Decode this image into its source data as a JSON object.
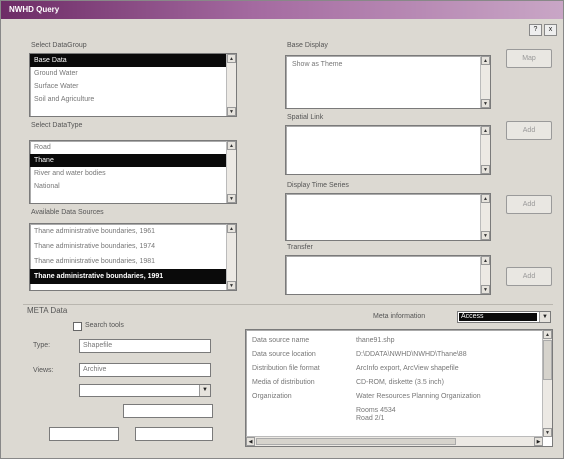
{
  "window": {
    "title": "NWHD Query"
  },
  "corner_buttons": [
    "x"
  ],
  "left": {
    "select_datagroup_label": "Select DataGroup",
    "datagroups": [
      "Base Data",
      "Ground Water",
      "Surface Water",
      "Soil and Agriculture"
    ],
    "datagroup_selected": 0,
    "select_datatype_label": "Select DataType",
    "datatypes": [
      "Road",
      "Thane",
      "River and water bodies",
      "National"
    ],
    "datatype_selected": 1,
    "available_label": "Available Data Sources",
    "sources": [
      "Thane administrative boundaries, 1961",
      "Thane administrative boundaries, 1974",
      "Thane administrative boundaries, 1981",
      "Thane administrative boundaries, 1991"
    ],
    "source_selected": 3
  },
  "middle": {
    "base_display_label": "Base Display",
    "base_display_items": [
      "Show as Theme"
    ],
    "spatial_link_label": "Spatial Link",
    "display_time_series_label": "Display Time Series",
    "transfer_label": "Transfer"
  },
  "buttons": {
    "b1": "Map",
    "b2": "Add",
    "b3": "Add",
    "b4": "Add"
  },
  "meta": {
    "section_label": "META Data",
    "search_label": "Search tools",
    "meta_info_label": "Meta information",
    "meta_info_value": "Access",
    "type_label": "Type:",
    "type_value": "Shapefile",
    "views_label": "Views:",
    "views_value": "Archive",
    "rows": [
      {
        "k": "Data source name",
        "v": "thane91.shp"
      },
      {
        "k": "Data source location",
        "v": "D:\\DDATA\\NWHD\\NWHD\\Thane\\88"
      },
      {
        "k": "Distribution file format",
        "v": "ArcInfo export, ArcView shapefile"
      },
      {
        "k": "Media of distribution",
        "v": "CD-ROM, diskette (3.5 inch)"
      },
      {
        "k": "Organization",
        "v": "Water Resources Planning Organization"
      },
      {
        "k": "",
        "v": "Rooms 4534"
      },
      {
        "k": "",
        "v": "Road 2/1"
      }
    ]
  }
}
